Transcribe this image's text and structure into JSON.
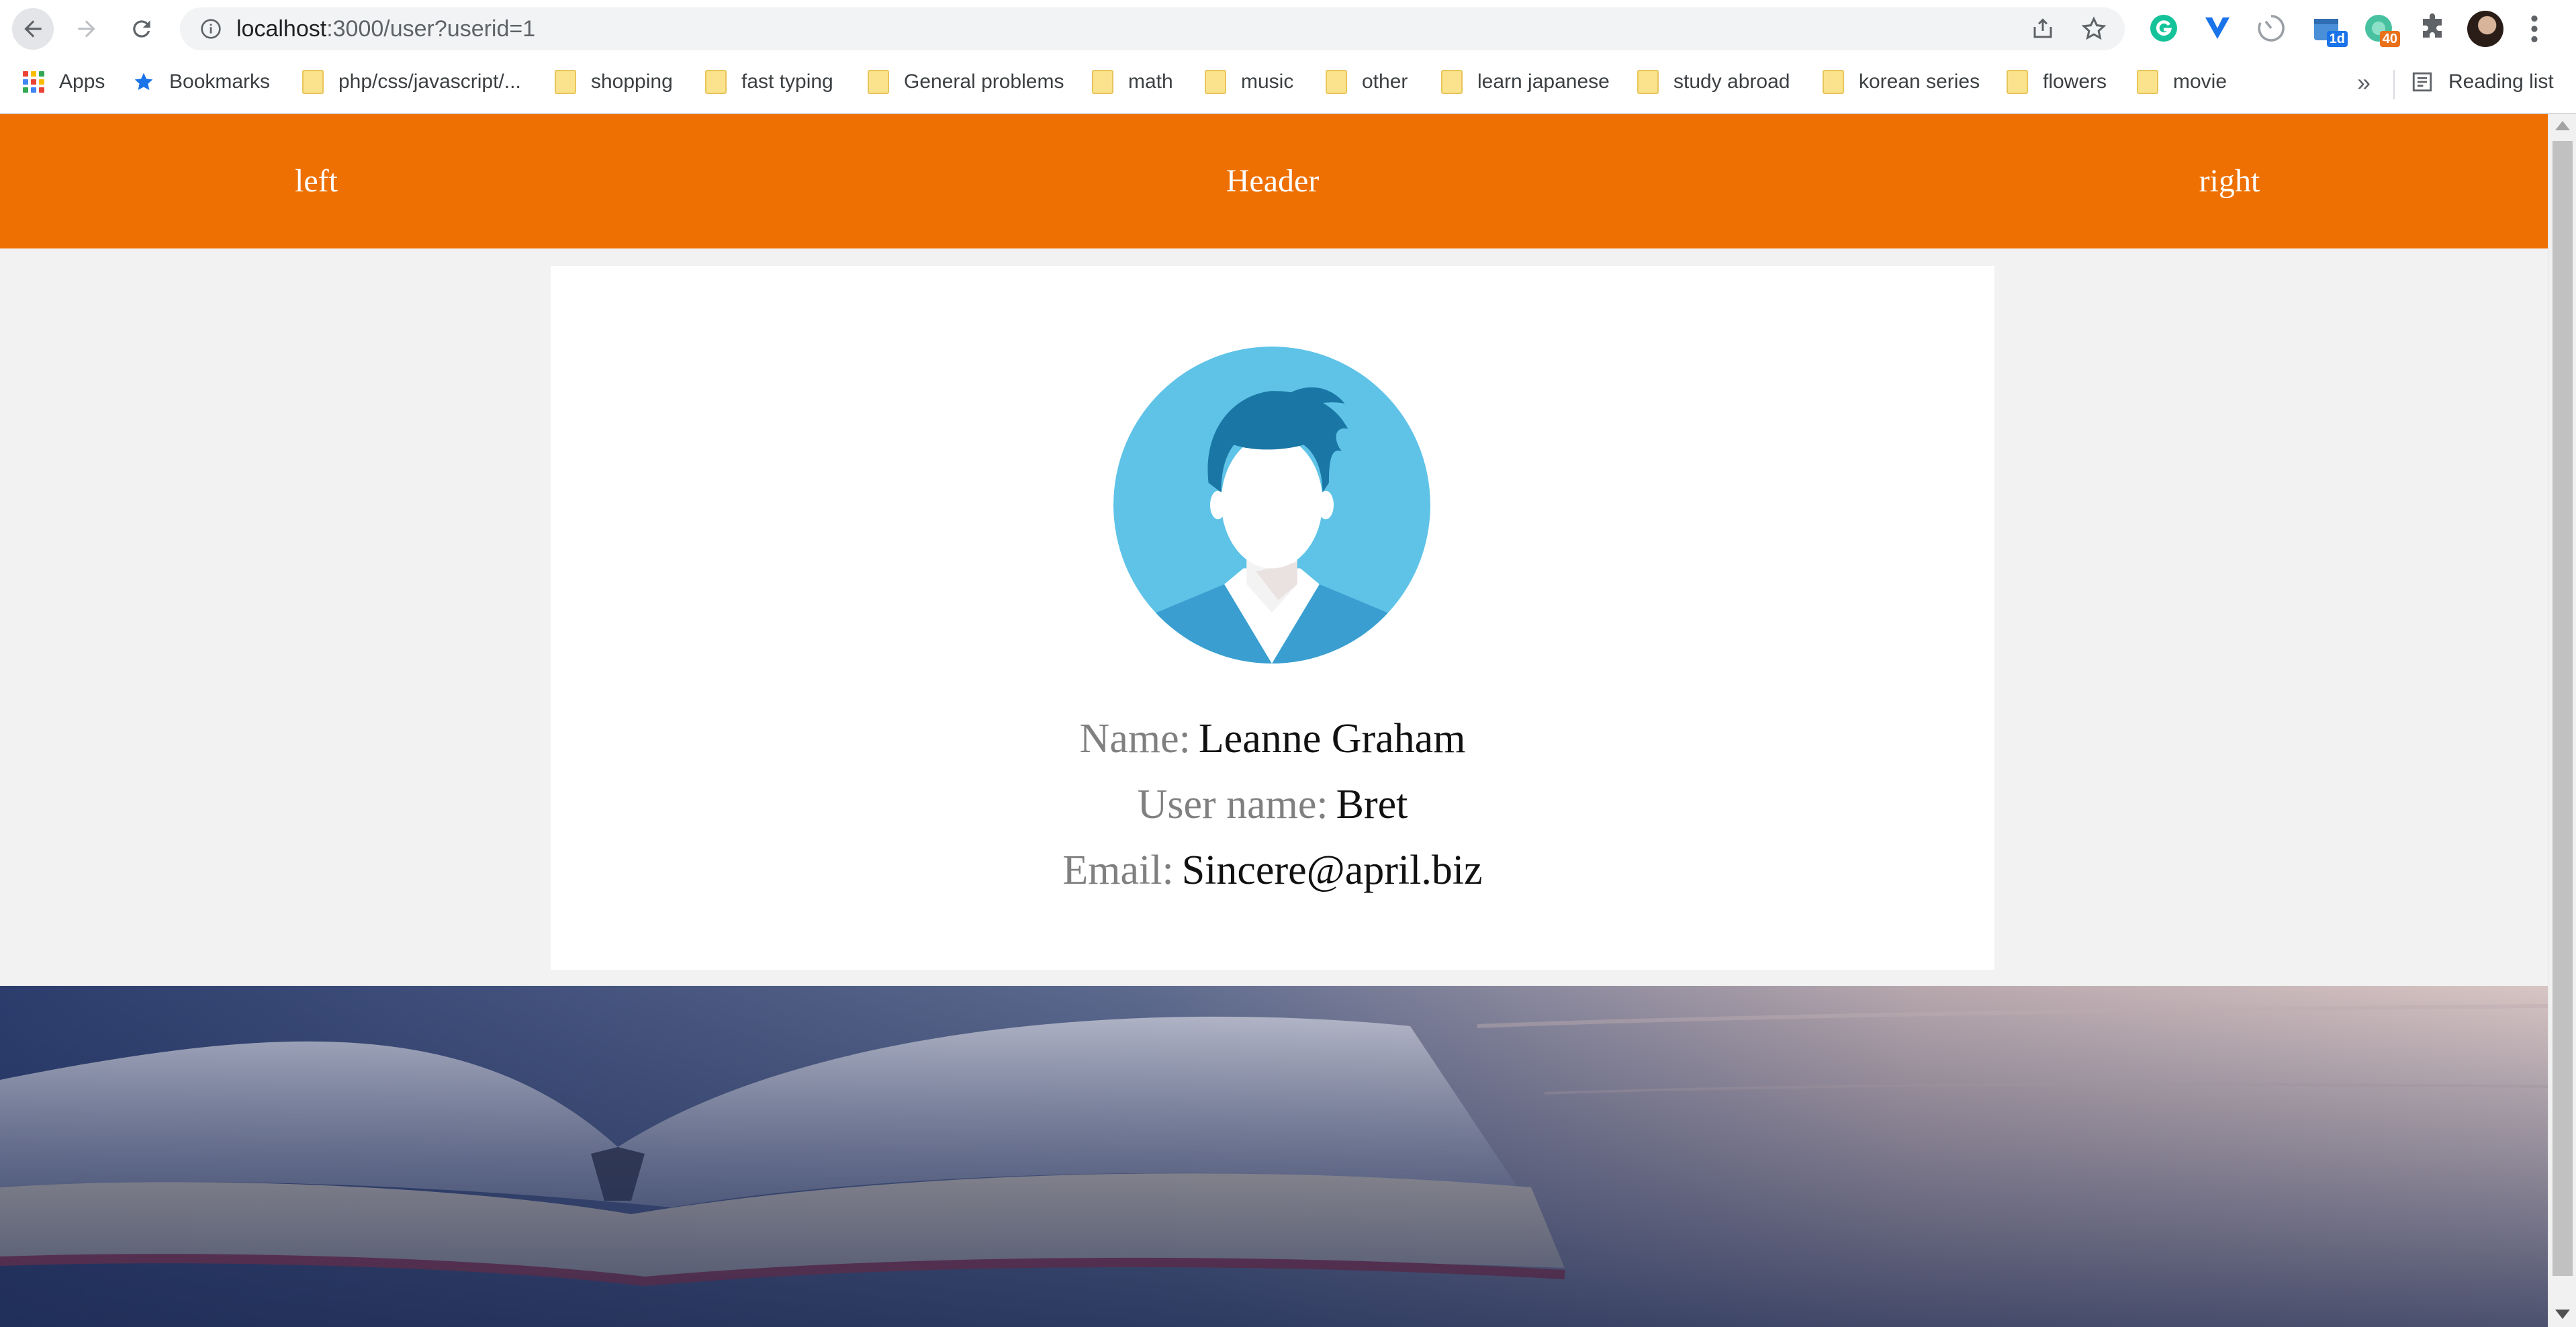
{
  "browser": {
    "url_host": "localhost",
    "url_rest": ":3000/user?userid=1",
    "extension_badges": {
      "calendar": "1d",
      "notes": "40"
    }
  },
  "bookmarks": {
    "items": [
      {
        "label": "Apps"
      },
      {
        "label": "Bookmarks"
      },
      {
        "label": "php/css/javascript/..."
      },
      {
        "label": "shopping"
      },
      {
        "label": "fast typing"
      },
      {
        "label": "General problems"
      },
      {
        "label": "math"
      },
      {
        "label": "music"
      },
      {
        "label": "other"
      },
      {
        "label": "learn japanese"
      },
      {
        "label": "study abroad"
      },
      {
        "label": "korean series"
      },
      {
        "label": "flowers"
      },
      {
        "label": "movie"
      }
    ],
    "overflow": "»",
    "reading_list": "Reading list"
  },
  "header": {
    "left": "left",
    "title": "Header",
    "right": "right"
  },
  "profile": {
    "name_label": "Name:",
    "name": "Leanne Graham",
    "username_label": "User name:",
    "username": "Bret",
    "email_label": "Email:",
    "email": "Sincere@april.biz"
  },
  "colors": {
    "header": "#ee7002",
    "avatar_bg": "#5fc3e8",
    "avatar_hair": "#1a77a5"
  }
}
